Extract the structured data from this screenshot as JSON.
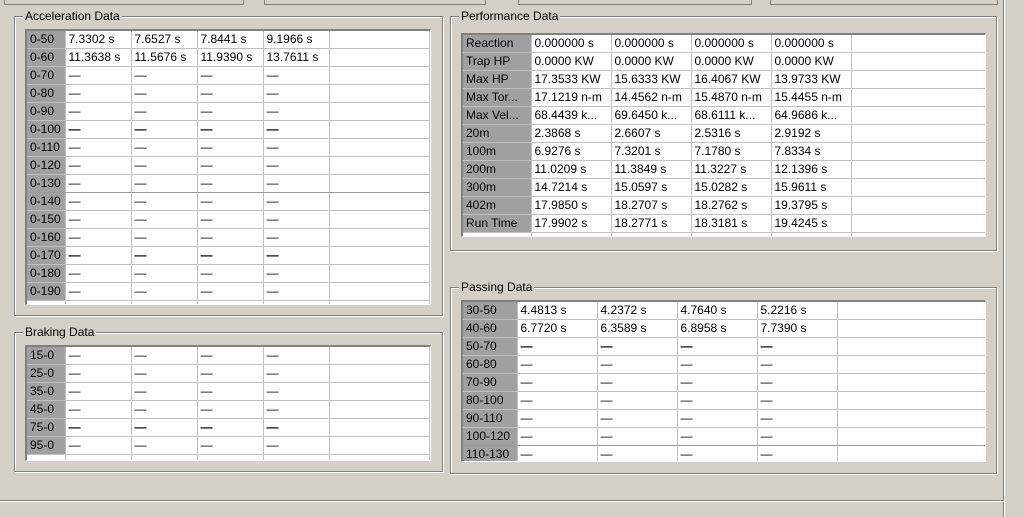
{
  "acceleration": {
    "title": "Acceleration Data",
    "rows": [
      {
        "label": "0-50",
        "values": [
          "7.3302 s",
          "7.6527 s",
          "7.8441 s",
          "9.1966 s"
        ]
      },
      {
        "label": "0-60",
        "values": [
          "11.3638 s",
          "11.5676 s",
          "11.9390 s",
          "13.7611 s"
        ]
      },
      {
        "label": "0-70",
        "values": [
          "—",
          "—",
          "—",
          "—"
        ]
      },
      {
        "label": "0-80",
        "values": [
          "—",
          "—",
          "—",
          "—"
        ]
      },
      {
        "label": "0-90",
        "values": [
          "—",
          "—",
          "—",
          "—"
        ]
      },
      {
        "label": "0-100",
        "values": [
          "—",
          "—",
          "—",
          "—"
        ]
      },
      {
        "label": "0-110",
        "values": [
          "—",
          "—",
          "—",
          "—"
        ]
      },
      {
        "label": "0-120",
        "values": [
          "—",
          "—",
          "—",
          "—"
        ]
      },
      {
        "label": "0-130",
        "values": [
          "—",
          "—",
          "—",
          "—"
        ]
      },
      {
        "label": "0-140",
        "values": [
          "—",
          "—",
          "—",
          "—"
        ]
      },
      {
        "label": "0-150",
        "values": [
          "—",
          "—",
          "—",
          "—"
        ]
      },
      {
        "label": "0-160",
        "values": [
          "—",
          "—",
          "—",
          "—"
        ]
      },
      {
        "label": "0-170",
        "values": [
          "—",
          "—",
          "—",
          "—"
        ]
      },
      {
        "label": "0-180",
        "values": [
          "—",
          "—",
          "—",
          "—"
        ]
      },
      {
        "label": "0-190",
        "values": [
          "—",
          "—",
          "—",
          "—"
        ]
      }
    ]
  },
  "braking": {
    "title": "Braking Data",
    "rows": [
      {
        "label": "15-0",
        "values": [
          "—",
          "—",
          "—",
          "—"
        ]
      },
      {
        "label": "25-0",
        "values": [
          "—",
          "—",
          "—",
          "—"
        ]
      },
      {
        "label": "35-0",
        "values": [
          "—",
          "—",
          "—",
          "—"
        ]
      },
      {
        "label": "45-0",
        "values": [
          "—",
          "—",
          "—",
          "—"
        ]
      },
      {
        "label": "75-0",
        "values": [
          "—",
          "—",
          "—",
          "—"
        ]
      },
      {
        "label": "95-0",
        "values": [
          "—",
          "—",
          "—",
          "—"
        ]
      }
    ]
  },
  "performance": {
    "title": "Performance Data",
    "rows": [
      {
        "label": "Reaction",
        "values": [
          "0.000000 s",
          "0.000000 s",
          "0.000000 s",
          "0.000000 s"
        ]
      },
      {
        "label": "Trap HP",
        "values": [
          "0.0000 KW",
          "0.0000 KW",
          "0.0000 KW",
          "0.0000 KW"
        ]
      },
      {
        "label": "Max HP",
        "values": [
          "17.3533 KW",
          "15.6333 KW",
          "16.4067 KW",
          "13.9733 KW"
        ]
      },
      {
        "label": "Max Tor...",
        "values": [
          "17.1219 n-m",
          "14.4562 n-m",
          "15.4870 n-m",
          "15.4455 n-m"
        ]
      },
      {
        "label": "Max Vel...",
        "values": [
          "68.4439 k...",
          "69.6450 k...",
          "68.6111 k...",
          "64.9686 k..."
        ]
      },
      {
        "label": "20m",
        "values": [
          "2.3868 s",
          "2.6607 s",
          "2.5316 s",
          "2.9192 s"
        ]
      },
      {
        "label": "100m",
        "values": [
          "6.9276 s",
          "7.3201 s",
          "7.1780 s",
          "7.8334 s"
        ]
      },
      {
        "label": "200m",
        "values": [
          "11.0209 s",
          "11.3849 s",
          "11.3227 s",
          "12.1396 s"
        ]
      },
      {
        "label": "300m",
        "values": [
          "14.7214 s",
          "15.0597 s",
          "15.0282 s",
          "15.9611 s"
        ]
      },
      {
        "label": "402m",
        "values": [
          "17.9850 s",
          "18.2707 s",
          "18.2762 s",
          "19.3795 s"
        ]
      },
      {
        "label": "Run Time",
        "values": [
          "17.9902 s",
          "18.2771 s",
          "18.3181 s",
          "19.4245 s"
        ]
      }
    ]
  },
  "passing": {
    "title": "Passing Data",
    "rows": [
      {
        "label": "30-50",
        "values": [
          "4.4813 s",
          "4.2372 s",
          "4.7640 s",
          "5.2216 s"
        ]
      },
      {
        "label": "40-60",
        "values": [
          "6.7720 s",
          "6.3589 s",
          "6.8958 s",
          "7.7390 s"
        ]
      },
      {
        "label": "50-70",
        "values": [
          "—",
          "—",
          "—",
          "—"
        ]
      },
      {
        "label": "60-80",
        "values": [
          "—",
          "—",
          "—",
          "—"
        ]
      },
      {
        "label": "70-90",
        "values": [
          "—",
          "—",
          "—",
          "—"
        ]
      },
      {
        "label": "80-100",
        "values": [
          "—",
          "—",
          "—",
          "—"
        ]
      },
      {
        "label": "90-110",
        "values": [
          "—",
          "—",
          "—",
          "—"
        ]
      },
      {
        "label": "100-120",
        "values": [
          "—",
          "—",
          "—",
          "—"
        ]
      },
      {
        "label": "110-130",
        "values": [
          "—",
          "—",
          "—",
          "—"
        ]
      }
    ]
  },
  "colors": {
    "background": "#d4d0c8",
    "header_cell": "#a0a0a0",
    "grid_line": "#c0c0c0",
    "cell_bg": "#ffffff"
  }
}
